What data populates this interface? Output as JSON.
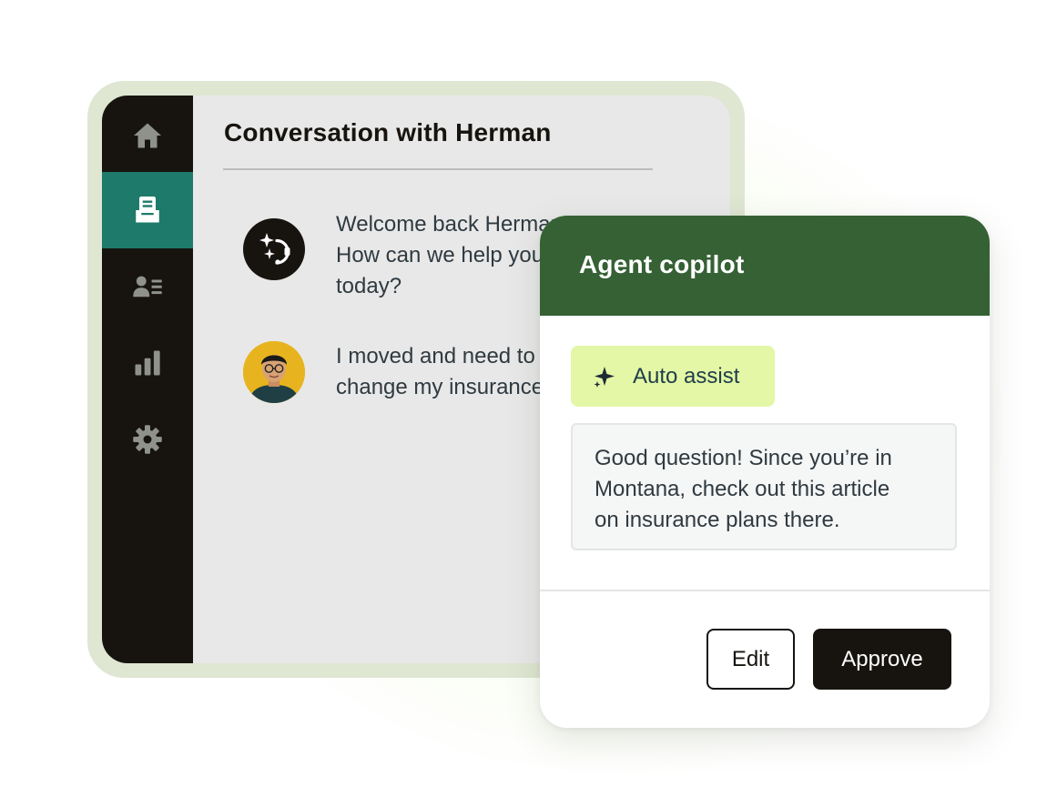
{
  "conversation": {
    "title": "Conversation with Herman",
    "messages": [
      {
        "sender": "bot",
        "avatar_icon": "sparkle-headset-icon",
        "text": "Welcome back Herman!\nHow can we help you\ntoday?"
      },
      {
        "sender": "user",
        "avatar_icon": "user-photo-avatar",
        "text": "I moved and need to\nchange my insurance"
      }
    ]
  },
  "sidebar": {
    "items": [
      {
        "icon": "home-icon",
        "active": false
      },
      {
        "icon": "inbox-icon",
        "active": true
      },
      {
        "icon": "contacts-icon",
        "active": false
      },
      {
        "icon": "bar-chart-icon",
        "active": false
      },
      {
        "icon": "gear-icon",
        "active": false
      }
    ]
  },
  "copilot": {
    "title": "Agent copilot",
    "auto_assist_label": "Auto assist",
    "suggestion": "Good question! Since you’re in\nMontana, check out this article\non insurance plans there.",
    "edit_label": "Edit",
    "approve_label": "Approve"
  },
  "colors": {
    "sidebar_bg": "#17140f",
    "sidebar_active": "#1e7a6a",
    "copilot_header": "#356134",
    "auto_assist_bg": "#e3f7a6",
    "frame_bg": "#dfe6d2",
    "approve_bg": "#17140f"
  }
}
